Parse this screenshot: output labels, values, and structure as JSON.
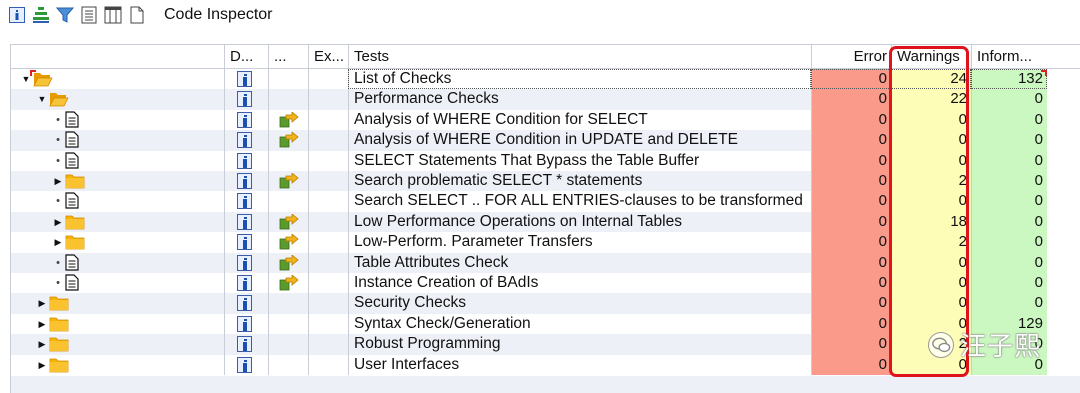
{
  "toolbar": {
    "title": "Code Inspector",
    "icons": [
      "info-icon",
      "hierarchy-icon",
      "filter-icon",
      "document-icon",
      "columns-icon",
      "page-icon"
    ]
  },
  "columns": {
    "d": "D...",
    "dots": "...",
    "ex": "Ex...",
    "tests": "Tests",
    "error": "Error",
    "warnings": "Warnings",
    "info": "Inform..."
  },
  "colors": {
    "error_bg": "#fa9a8a",
    "warnings_bg": "#fdfdb8",
    "info_bg": "#cbf7c1",
    "highlight": "#e0121b",
    "folder": "#f5b400"
  },
  "rows": [
    {
      "level": 0,
      "node": "folder-open",
      "expander": "expanded",
      "has_nav": false,
      "test": "List of Checks",
      "error": "0",
      "warnings": "24",
      "info": "132"
    },
    {
      "level": 1,
      "node": "folder-open",
      "expander": "expanded",
      "has_nav": false,
      "test": "Performance Checks",
      "error": "0",
      "warnings": "22",
      "info": "0"
    },
    {
      "level": 2,
      "node": "document",
      "expander": "leaf",
      "has_nav": true,
      "test": "Analysis of WHERE Condition for SELECT",
      "error": "0",
      "warnings": "0",
      "info": "0"
    },
    {
      "level": 2,
      "node": "document",
      "expander": "leaf",
      "has_nav": true,
      "test": "Analysis of WHERE Condition in UPDATE and DELETE",
      "error": "0",
      "warnings": "0",
      "info": "0"
    },
    {
      "level": 2,
      "node": "document",
      "expander": "leaf",
      "has_nav": false,
      "test": "SELECT Statements That Bypass the Table Buffer",
      "error": "0",
      "warnings": "0",
      "info": "0"
    },
    {
      "level": 2,
      "node": "folder",
      "expander": "collapsed",
      "has_nav": true,
      "test": "Search problematic SELECT * statements",
      "error": "0",
      "warnings": "2",
      "info": "0"
    },
    {
      "level": 2,
      "node": "document",
      "expander": "leaf",
      "has_nav": false,
      "test": "Search SELECT .. FOR ALL ENTRIES-clauses to be transformed",
      "error": "0",
      "warnings": "0",
      "info": "0"
    },
    {
      "level": 2,
      "node": "folder",
      "expander": "collapsed",
      "has_nav": true,
      "test": "Low Performance Operations on Internal Tables",
      "error": "0",
      "warnings": "18",
      "info": "0"
    },
    {
      "level": 2,
      "node": "folder",
      "expander": "collapsed",
      "has_nav": true,
      "test": "Low-Perform. Parameter Transfers",
      "error": "0",
      "warnings": "2",
      "info": "0"
    },
    {
      "level": 2,
      "node": "document",
      "expander": "leaf",
      "has_nav": true,
      "test": "Table Attributes Check",
      "error": "0",
      "warnings": "0",
      "info": "0"
    },
    {
      "level": 2,
      "node": "document",
      "expander": "leaf",
      "has_nav": true,
      "test": "Instance Creation of BAdIs",
      "error": "0",
      "warnings": "0",
      "info": "0"
    },
    {
      "level": 1,
      "node": "folder",
      "expander": "collapsed",
      "has_nav": false,
      "test": "Security Checks",
      "error": "0",
      "warnings": "0",
      "info": "0"
    },
    {
      "level": 1,
      "node": "folder",
      "expander": "collapsed",
      "has_nav": false,
      "test": "Syntax Check/Generation",
      "error": "0",
      "warnings": "0",
      "info": "129"
    },
    {
      "level": 1,
      "node": "folder",
      "expander": "collapsed",
      "has_nav": false,
      "test": "Robust Programming",
      "error": "0",
      "warnings": "2",
      "info": "0"
    },
    {
      "level": 1,
      "node": "folder",
      "expander": "collapsed",
      "has_nav": false,
      "test": "User Interfaces",
      "error": "0",
      "warnings": "0",
      "info": "0"
    }
  ],
  "watermark": {
    "text": "汪子熙",
    "icon": "wechat-icon"
  }
}
